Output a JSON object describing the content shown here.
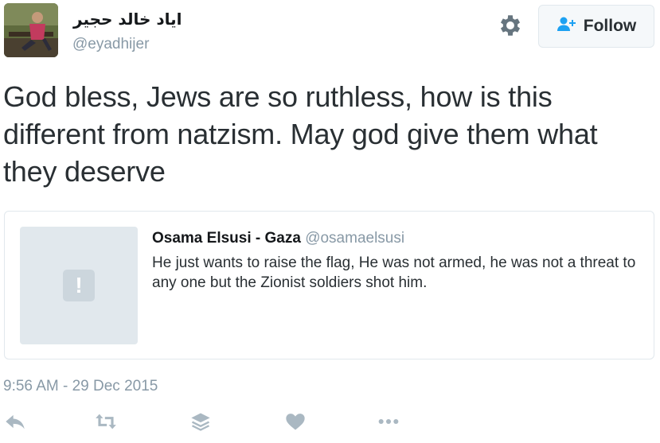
{
  "user": {
    "display_name": "اياد خالد حجير",
    "handle": "@eyadhijer"
  },
  "follow_button": {
    "label": "Follow"
  },
  "tweet": {
    "text": "God bless, Jews are so ruthless, how is this different from natzism. May god give them what they deserve",
    "timestamp": "9:56 AM - 29 Dec 2015"
  },
  "quote": {
    "name": "Osama Elsusi - Gaza",
    "handle": "@osamaelsusi",
    "text": "He just wants to raise the flag, He was not armed, he was not a threat to any one but the Zionist soldiers shot him.",
    "media_placeholder_glyph": "!"
  },
  "icons": {
    "settings": "gear-icon",
    "follow": "add-user-icon",
    "reply": "reply-icon",
    "retweet": "retweet-icon",
    "buffer": "layers-icon",
    "like": "heart-icon",
    "more": "more-icon",
    "media_missing": "exclamation-icon"
  },
  "colors": {
    "text": "#292f33",
    "secondary": "#8899a6",
    "border": "#e1e8ed",
    "follow_icon": "#1da1f2",
    "action_icon": "#aab8c2"
  }
}
